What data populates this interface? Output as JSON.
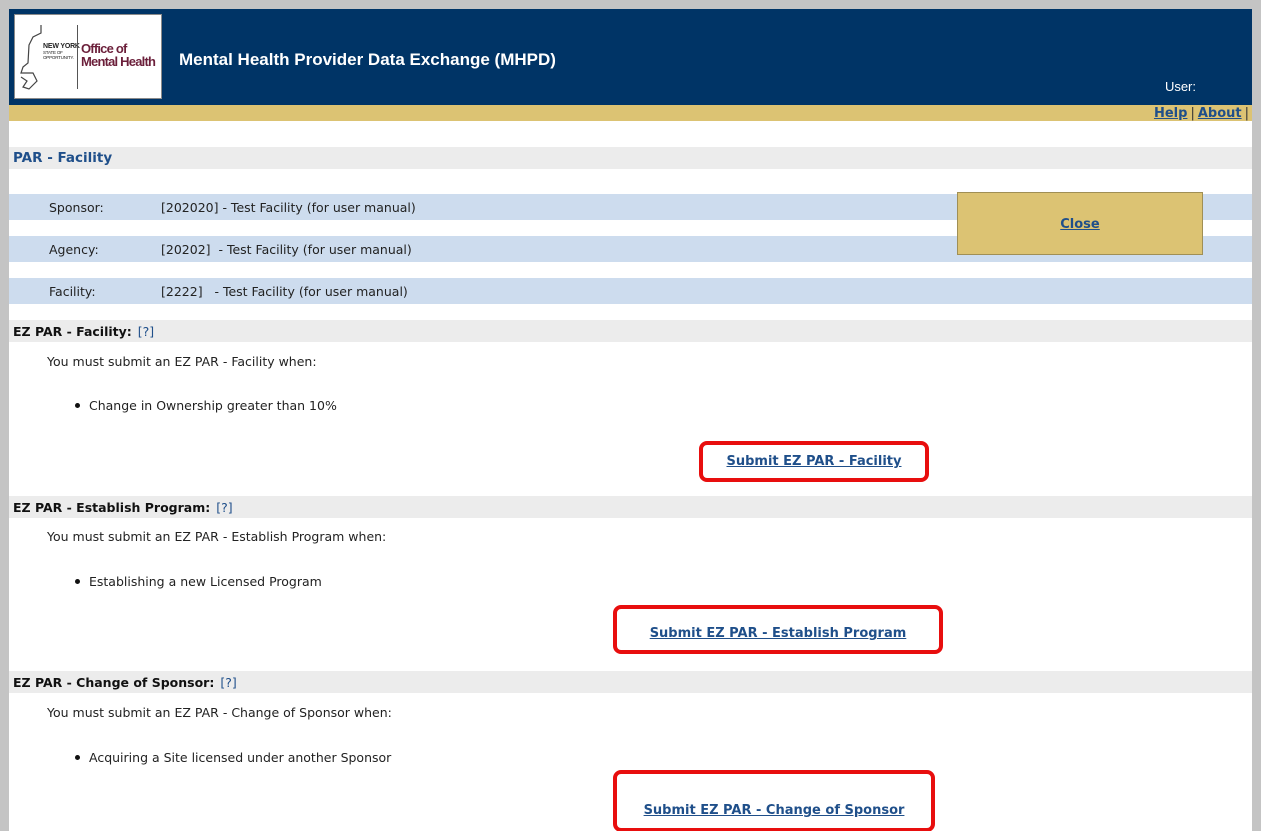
{
  "logo": {
    "state_line1": "NEW YORK",
    "state_line2": "STATE OF",
    "state_line3": "OPPORTUNITY.",
    "agency_line1": "Office of",
    "agency_line2": "Mental Health"
  },
  "header": {
    "title": "Mental Health Provider Data Exchange (MHPD)",
    "user_label": "User:",
    "background_color": "#003466",
    "accent_color": "#dcc373"
  },
  "top_links": {
    "help": "Help",
    "separator": "|",
    "about": "About"
  },
  "page": {
    "title": "PAR - Facility"
  },
  "info": {
    "sponsor_label": "Sponsor:",
    "sponsor_value": "[202020] - Test Facility (for user manual)",
    "agency_label": "Agency:",
    "agency_value": "[20202]  - Test Facility (for user manual)",
    "facility_label": "Facility:",
    "facility_value": "[2222]   - Test Facility (for user manual)"
  },
  "close": {
    "label": "Close"
  },
  "sections": [
    {
      "title": "EZ PAR - Facility:",
      "help": "[?]",
      "description": "You must submit an EZ PAR - Facility when:",
      "bullet": "Change in Ownership greater than 10%",
      "submit_label": "Submit EZ PAR - Facility"
    },
    {
      "title": "EZ PAR - Establish Program:",
      "help": "[?]",
      "description": "You must submit an EZ PAR - Establish Program when:",
      "bullet": "Establishing a new Licensed Program",
      "submit_label": "Submit EZ PAR - Establish Program"
    },
    {
      "title": "EZ PAR - Change of Sponsor:",
      "help": "[?]",
      "description": "You must submit an EZ PAR - Change of Sponsor when:",
      "bullet": "Acquiring a Site licensed under another Sponsor",
      "submit_label": "Submit EZ PAR - Change of Sponsor"
    }
  ]
}
